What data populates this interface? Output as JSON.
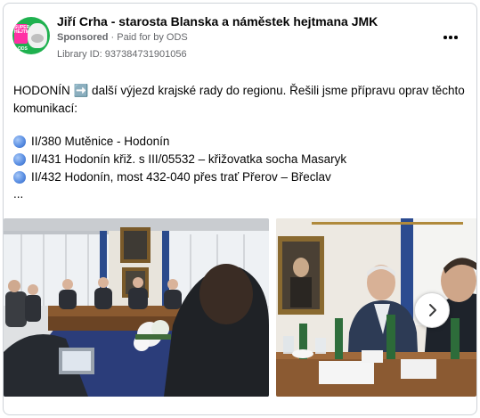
{
  "page": {
    "name": "Jiří Crha - starosta Blanska a náměstek hejtmana JMK",
    "sponsored": "Sponsored",
    "paid_for": "Paid for by ODS",
    "library_id": "Library ID: 937384731901056",
    "avatar_badge": "SUPER HEJTMAN",
    "avatar_brand": "ODS"
  },
  "post": {
    "intro": "HODONÍN ➡️ další výjezd krajské rady do regionu. Řešili jsme přípravu oprav těchto komunikací:",
    "routes": [
      "II/380 Mutěnice - Hodonín",
      "II/431 Hodonín křiž. s III/05532 – křižovatka socha Masaryk",
      "II/432 Hodonín, most 432-040 přes trať Přerov – Břeclav"
    ],
    "ellipsis": "..."
  },
  "colors": {
    "accent_green": "#1fb14f",
    "badge_pink": "#ff2fa5",
    "text_secondary": "#65676b",
    "route_dot": "#5b8fe3"
  },
  "icons": {
    "more": "more-horizontal-icon",
    "next": "chevron-right-icon",
    "route": "blue-circle-icon"
  }
}
